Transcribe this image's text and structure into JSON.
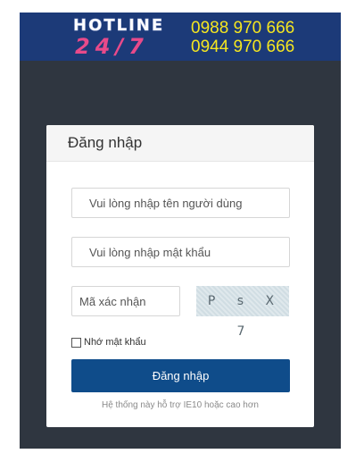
{
  "hotline": {
    "word": "HOTLINE",
    "hours": "24/7",
    "phones": [
      "0988 970 666",
      "0944 970 666"
    ]
  },
  "login": {
    "title": "Đăng nhập",
    "username_placeholder": "Vui lòng nhập tên người dùng",
    "password_placeholder": "Vui lòng nhập mật khẩu",
    "captcha_placeholder": "Mã xác nhận",
    "captcha_text": "P s X 7",
    "remember_label": "Nhớ mật khẩu",
    "submit_label": "Đăng nhập",
    "browser_note": "Hệ thống này hỗ trợ IE10 hoặc cao hơn"
  },
  "colors": {
    "background": "#2f3640",
    "hotline_bar": "#1c3a78",
    "phone_text": "#f5e620",
    "hours_text": "#e84a8a",
    "button": "#0f4c8a"
  }
}
